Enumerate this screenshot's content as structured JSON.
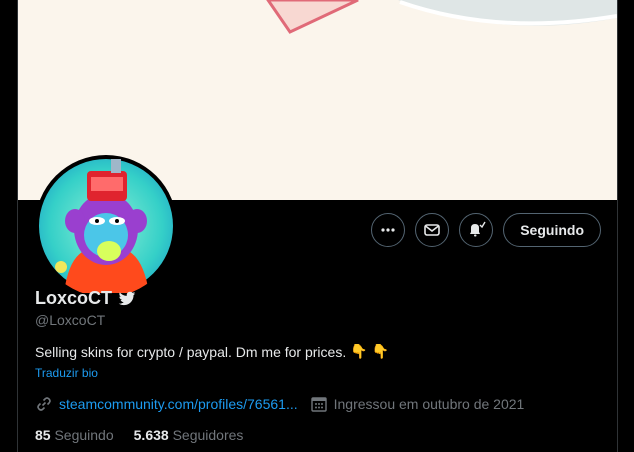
{
  "profile": {
    "display_name": "LoxcoCT",
    "handle": "@LoxcoCT",
    "bio": "Selling skins for crypto / paypal. Dm me for prices.",
    "bio_emoji": "👇 👇",
    "translate_label": "Traduzir bio",
    "website": "steamcommunity.com/profiles/76561...",
    "joined": "Ingressou em outubro de 2021",
    "following_count": "85",
    "following_label": "Seguindo",
    "followers_count": "5.638",
    "followers_label": "Seguidores"
  },
  "actions": {
    "follow_label": "Seguindo",
    "more_icon": "more-icon",
    "message_icon": "mail-icon",
    "notify_icon": "bell-icon"
  },
  "colors": {
    "accent": "#1d9bf0",
    "background": "#000000",
    "banner": "#fbf5ec"
  }
}
